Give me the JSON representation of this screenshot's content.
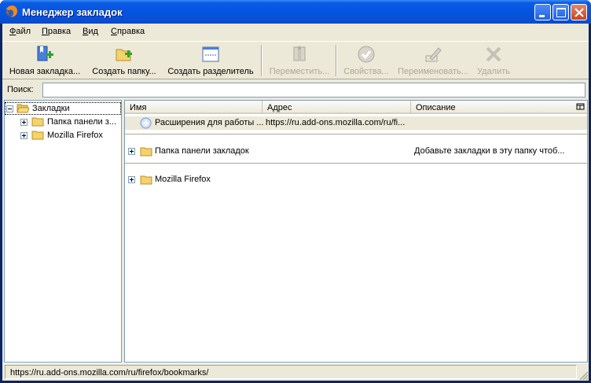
{
  "window": {
    "title": "Менеджер закладок"
  },
  "menu": [
    {
      "label": "Файл",
      "accel": "Ф"
    },
    {
      "label": "Правка",
      "accel": "П"
    },
    {
      "label": "Вид",
      "accel": "В"
    },
    {
      "label": "Справка",
      "accel": "С"
    }
  ],
  "toolbar": {
    "new_bookmark": "Новая закладка...",
    "new_folder": "Создать папку...",
    "new_separator": "Создать разделитель",
    "move": "Переместить...",
    "properties": "Свойства...",
    "rename": "Переименовать...",
    "delete": "Удалить"
  },
  "search": {
    "label": "Поиск:",
    "value": "",
    "placeholder": ""
  },
  "tree": [
    {
      "label": "Закладки",
      "expanded": true
    },
    {
      "label": "Папка панели з..."
    },
    {
      "label": "Mozilla Firefox"
    }
  ],
  "columns": {
    "name": "Имя",
    "address": "Адрес",
    "description": "Описание"
  },
  "rows": [
    {
      "name": "Расширения для работы ...",
      "address": "https://ru.add-ons.mozilla.com/ru/fi...",
      "description": "",
      "icon": "bookmark-icon"
    },
    {
      "name": "Папка панели закладок",
      "address": "",
      "description": "Добавьте закладки в эту папку чтоб...",
      "icon": "folder-icon"
    },
    {
      "name": "Mozilla Firefox",
      "address": "",
      "description": "",
      "icon": "folder-icon"
    }
  ],
  "status": {
    "text": "https://ru.add-ons.mozilla.com/ru/firefox/bookmarks/"
  },
  "colors": {
    "titlebar": "#0554e0",
    "face": "#ece9d8",
    "folder": "#f5d36a",
    "border": "#7f9db9"
  }
}
